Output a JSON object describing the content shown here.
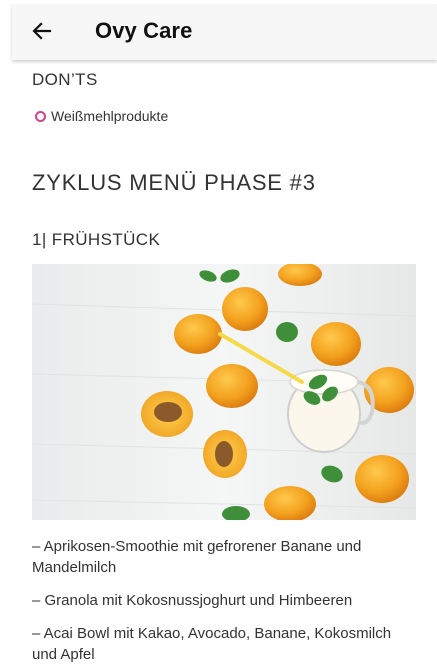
{
  "header": {
    "back_icon": "arrow-left-icon",
    "title": "Ovy Care"
  },
  "donts": {
    "heading": "DON’TS",
    "items": [
      "Weißmehlprodukte"
    ]
  },
  "menu": {
    "heading": "ZYKLUS MENÜ PHASE #3",
    "meal_heading": "1| FRÜHSTÜCK",
    "items": [
      "– Aprikosen-Smoothie mit gefrorener Banane und Mandelmilch",
      "– Granola mit Kokosnussjoghurt und Himbeeren",
      "– Acai Bowl mit  Kakao, Avocado, Banane, Kokosmilch und Apfel"
    ]
  },
  "colors": {
    "accent": "#d3448f",
    "appbar_bg": "#f7f7f7"
  }
}
